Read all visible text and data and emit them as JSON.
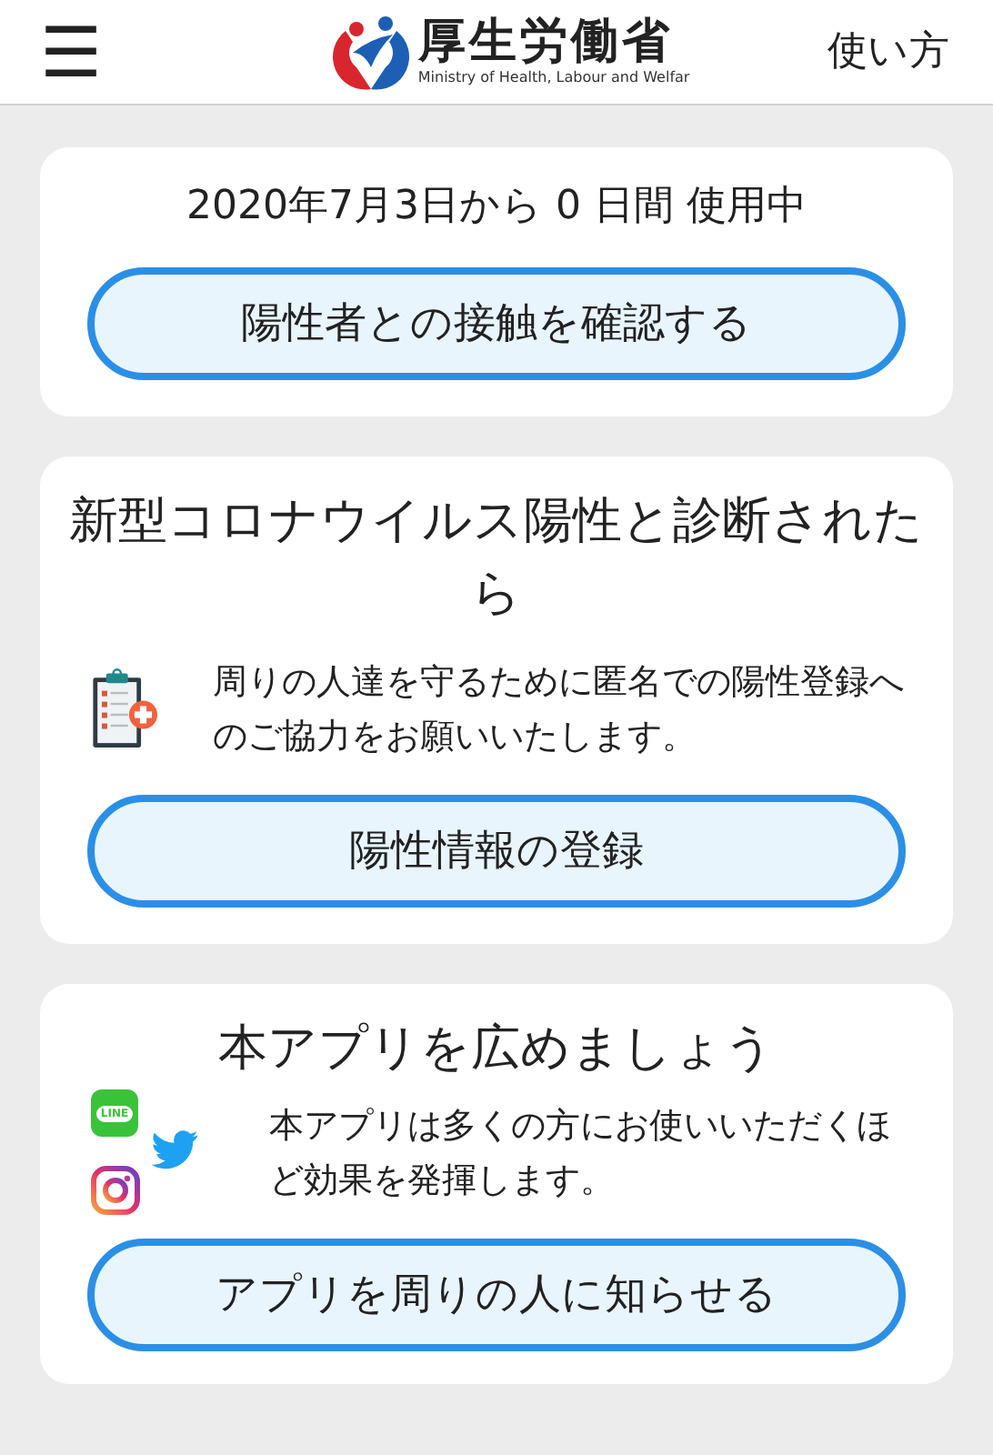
{
  "header": {
    "menu_icon": "☰",
    "logo_title": "厚生労働省",
    "logo_subtitle": "Ministry of Health, Labour and Welfar",
    "help_link": "使い方"
  },
  "cards": [
    {
      "kind": "status",
      "status": "2020年7月3日から 0 日間 使用中",
      "button": "陽性者との接触を確認する"
    },
    {
      "kind": "report",
      "title": "新型コロナウイルス陽性と診断されたら",
      "body": "周りの人達を守るために匿名での陽性登録へのご協力をお願いいたします。",
      "button": "陽性情報の登録"
    },
    {
      "kind": "share",
      "title": "本アプリを広めましょう",
      "line_label": "LINE",
      "body": "本アプリは多くの方にお使いいただくほど効果を発揮します。",
      "button": "アプリを周りの人に知らせる"
    }
  ]
}
